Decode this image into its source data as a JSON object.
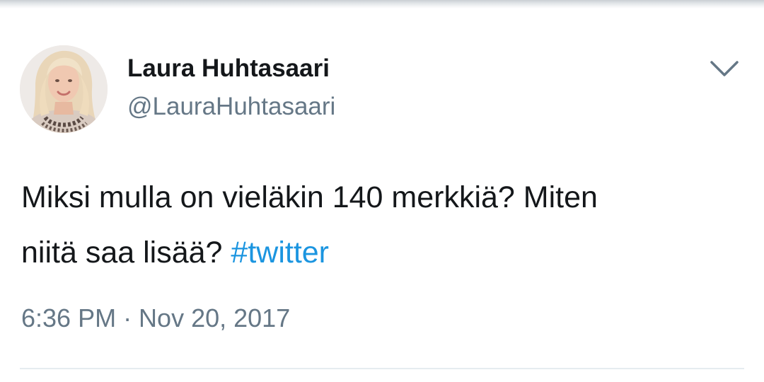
{
  "tweet": {
    "author": {
      "display_name": "Laura Huhtasaari",
      "handle": "@LauraHuhtasaari"
    },
    "text_line1": "Miksi mulla on vieläkin 140 merkkiä? Miten",
    "text_line2_plain": "niitä saa lisää? ",
    "hashtag": "#twitter",
    "timestamp": "6:36 PM · Nov 20, 2017",
    "menu_icon": "chevron-down-icon"
  },
  "colors": {
    "text": "#14171a",
    "secondary": "#657786",
    "link": "#1b95e0",
    "divider": "#e6ecf0"
  }
}
